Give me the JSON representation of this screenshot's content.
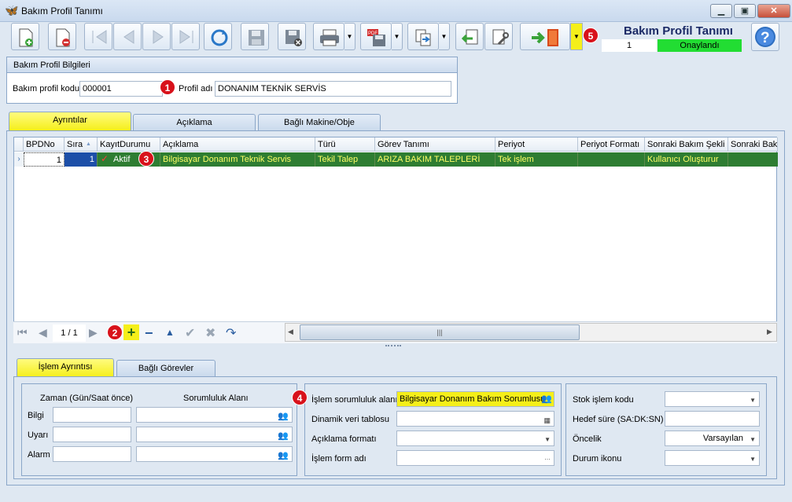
{
  "window": {
    "title": "Bakım Profil Tanımı",
    "minimize": "▁",
    "maximize": "▣",
    "close": "✕"
  },
  "header": {
    "form_title": "Bakım Profil Tanımı",
    "record_no": "1",
    "status": "Onaylandı"
  },
  "badges": {
    "b1": "1",
    "b2": "2",
    "b3": "3",
    "b4": "4",
    "b5": "5"
  },
  "profile_group": {
    "title": "Bakım Profil Bilgileri",
    "code_label": "Bakım profil kodu",
    "code_value": "000001",
    "name_label": "Profil adı",
    "name_value": "DONANIM TEKNİK SERVİS"
  },
  "tabs": [
    {
      "label": "Ayrıntılar",
      "active": true
    },
    {
      "label": "Açıklama",
      "active": false
    },
    {
      "label": "Bağlı Makine/Obje",
      "active": false
    }
  ],
  "grid": {
    "columns": [
      "BPDNo",
      "Sıra",
      "KayıtDurumu",
      "Açıklama",
      "Türü",
      "Görev Tanımı",
      "Periyot",
      "Periyot Formatı",
      "Sonraki Bakım Şekli",
      "Sonraki Bakı"
    ],
    "row": {
      "bpdno": "1",
      "sira": "1",
      "kayit_durumu": "Aktif",
      "aciklama": "Bilgisayar Donanım Teknik Servis",
      "turu": "Tekil Talep",
      "gorev": "ARIZA BAKIM TALEPLERİ",
      "periyot": "Tek işlem",
      "periyot_formati": "",
      "sonraki_bakim": "Kullanıcı Oluşturur",
      "sonraki_baki": ""
    },
    "pager": "1 / 1",
    "thumb_grip": "|||"
  },
  "lower_tabs": [
    {
      "label": "İşlem Ayrıntısı",
      "active": true
    },
    {
      "label": "Bağlı Görevler",
      "active": false
    }
  ],
  "left_panel": {
    "col1": "Zaman (Gün/Saat önce)",
    "col2": "Sorumluluk Alanı",
    "rows": [
      "Bilgi",
      "Uyarı",
      "Alarm"
    ]
  },
  "middle_panel": {
    "sorumluluk_label": "İşlem sorumluluk alanı",
    "sorumluluk_value": "Bilgisayar Donanım Bakım Sorumlusu",
    "dinamik_label": "Dinamik veri tablosu",
    "aciklama_format_label": "Açıklama formatı",
    "form_adi_label": "İşlem form adı"
  },
  "right_panel": {
    "stok_label": "Stok işlem kodu",
    "hedef_label": "Hedef süre (SA:DK:SN)",
    "oncelik_label": "Öncelik",
    "oncelik_value": "Varsayılan",
    "durum_label": "Durum ikonu"
  },
  "colors": {
    "selected_row": "#2e7d32",
    "row_text": "#ffff66",
    "active_tab": "#f5ef1a",
    "status_ok": "#22dd33",
    "badge": "#d8121b"
  }
}
